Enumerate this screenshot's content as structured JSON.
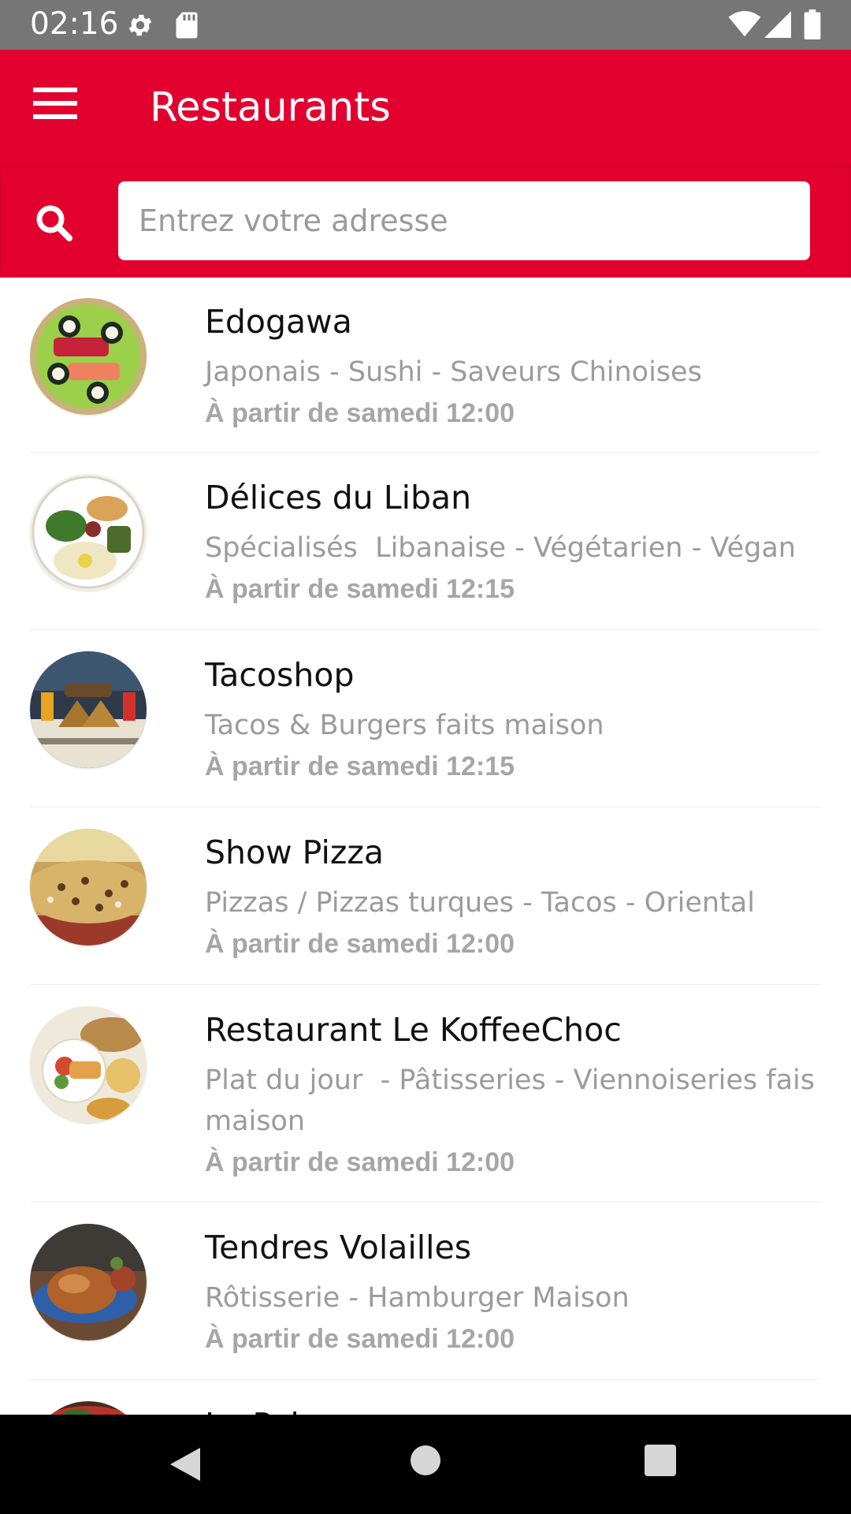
{
  "status_bar": {
    "time": "02:16",
    "icons": [
      "settings-icon",
      "sd-card-icon",
      "wifi-icon",
      "signal-icon",
      "battery-icon"
    ]
  },
  "app_bar": {
    "title": "Restaurants",
    "menu_icon": "hamburger-menu-icon",
    "background_color": "#e2002f"
  },
  "search": {
    "icon": "search-icon",
    "placeholder": "Entrez votre adresse",
    "value": ""
  },
  "restaurants": [
    {
      "name": "Edogawa",
      "categories": "Japonais - Sushi - Saveurs Chinoises",
      "availability": "À partir de samedi 12:00",
      "image": "sushi-photo"
    },
    {
      "name": "Délices du Liban",
      "categories": "Spécialisés  Libanaise - Végétarien - Végan",
      "availability": "À partir de samedi 12:15",
      "image": "lebanese-platter-photo"
    },
    {
      "name": "Tacoshop",
      "categories": "Tacos & Burgers faits maison",
      "availability": "À partir de samedi 12:15",
      "image": "tacos-burgers-photo"
    },
    {
      "name": "Show Pizza",
      "categories": "Pizzas / Pizzas turques - Tacos - Oriental",
      "availability": "À partir de samedi 12:00",
      "image": "pizza-photo"
    },
    {
      "name": "Restaurant Le KoffeeChoc",
      "categories": "Plat du jour  - Pâtisseries - Viennoiseries fais maison",
      "availability": "À partir de samedi 12:00",
      "image": "plat-du-jour-photo"
    },
    {
      "name": "Tendres Volailles",
      "categories": "Rôtisserie - Hamburger Maison",
      "availability": "À partir de samedi 12:00",
      "image": "roast-chicken-photo"
    },
    {
      "name": "Le Pal...",
      "categories": "",
      "availability": "",
      "image": "partially-visible-photo"
    }
  ],
  "nav_bar": {
    "buttons": [
      "back-triangle-icon",
      "home-circle-icon",
      "recents-square-icon"
    ]
  }
}
